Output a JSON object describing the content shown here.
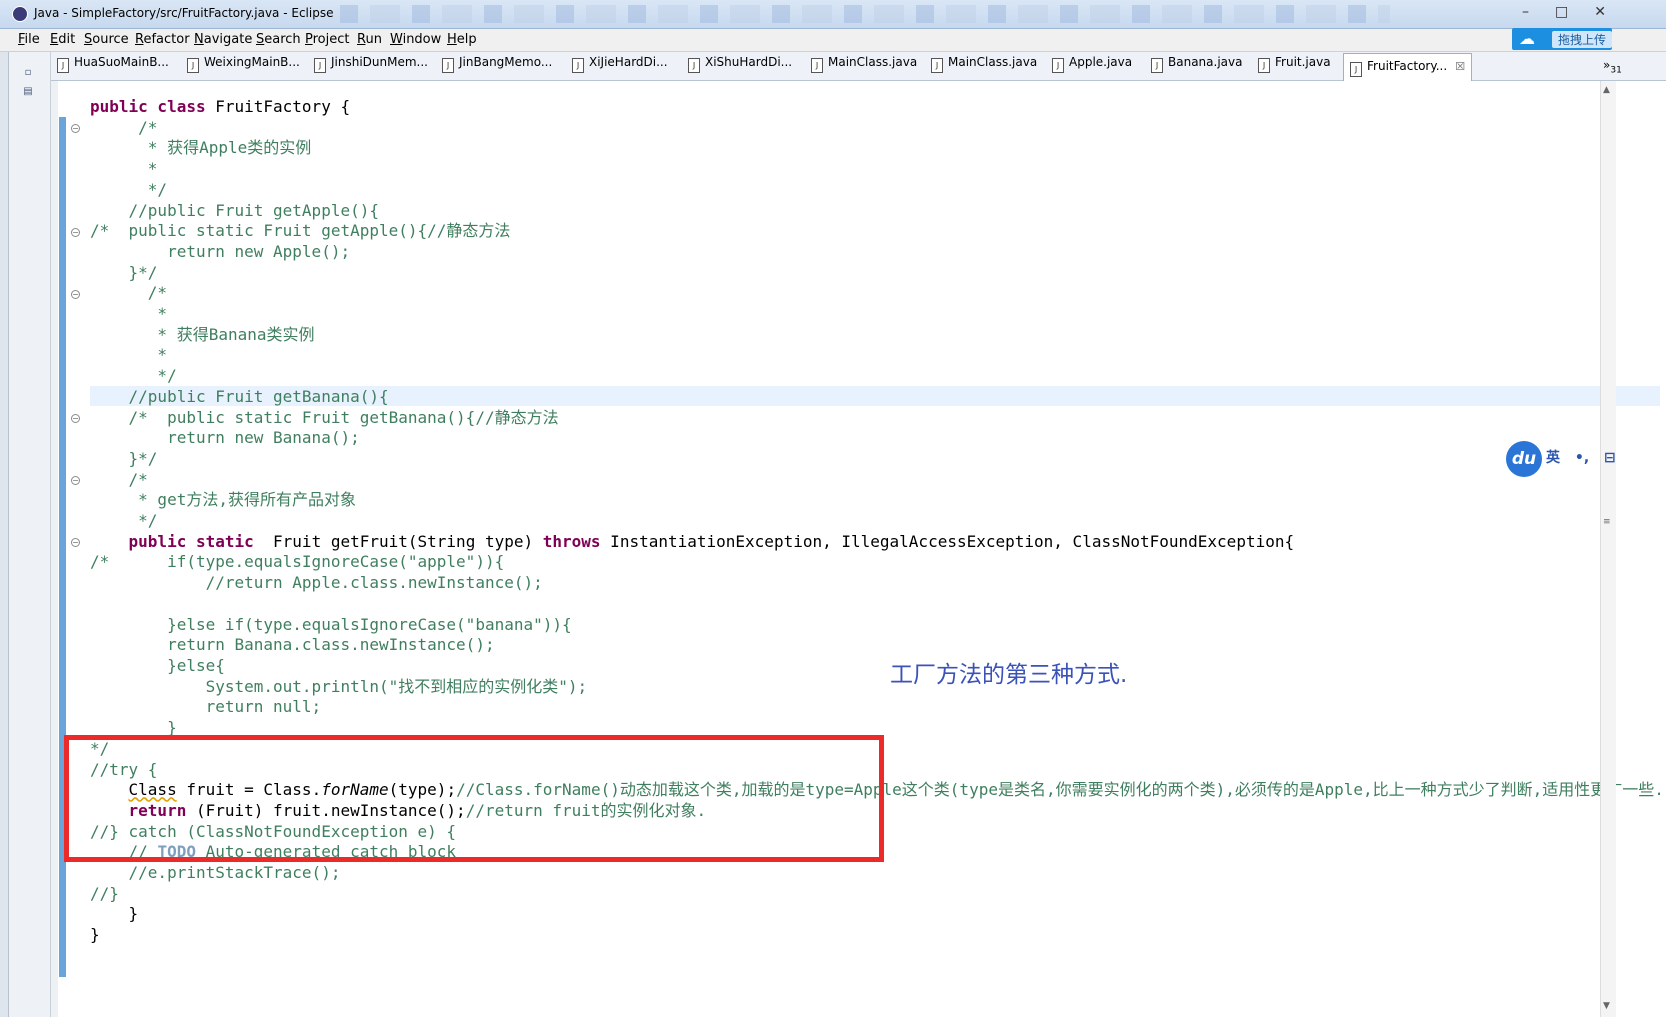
{
  "window": {
    "title": "Java - SimpleFactory/src/FruitFactory.java - Eclipse",
    "controls": [
      "–",
      "□",
      "✕"
    ]
  },
  "menu": [
    "File",
    "Edit",
    "Source",
    "Refactor",
    "Navigate",
    "Search",
    "Project",
    "Run",
    "Window",
    "Help"
  ],
  "upload_button": {
    "label": "拖拽上传",
    "icon": "cloud-icon"
  },
  "tabs": [
    "HuaSuoMainB...",
    "WeixingMainB...",
    "JinshiDunMem...",
    "JinBangMemo...",
    "XiJieHardDi...",
    "XiShuHardDi...",
    "MainClass.java",
    "MainClass.java",
    "Apple.java",
    "Banana.java",
    "Fruit.java"
  ],
  "active_tab": {
    "label": "FruitFactory...",
    "close": "☒"
  },
  "tabs_overflow": {
    "chevron": "»",
    "count": "31"
  },
  "code": {
    "l1": "public class FruitFactory {",
    "l2": "     /*",
    "l3": "      * 获得Apple类的实例",
    "l4": "      *",
    "l5": "      */",
    "l6": "    //public Fruit getApple(){",
    "l7": "/*  public static Fruit getApple(){//静态方法",
    "l8": "        return new Apple();",
    "l9": "    }*/",
    "l10": "      /*",
    "l11": "       *",
    "l12": "       * 获得Banana类实例",
    "l13": "       *",
    "l14": "       */",
    "l15": "    //public Fruit getBanana(){",
    "l16": "    /*  public static Fruit getBanana(){//静态方法",
    "l17": "        return new Banana();",
    "l18": "    }*/",
    "l19": "    /*",
    "l20": "     * get方法,获得所有产品对象",
    "l21": "     */",
    "l22": "    public static  Fruit getFruit(String type) throws InstantiationException, IllegalAccessException, ClassNotFoundException{",
    "l23": "/*      if(type.equalsIgnoreCase(\"apple\")){",
    "l24": "            //return Apple.class.newInstance();",
    "l25": "",
    "l26": "        }else if(type.equalsIgnoreCase(\"banana\")){",
    "l27": "        return Banana.class.newInstance();",
    "l28": "        }else{",
    "l29": "            System.out.println(\"找不到相应的实例化类\");",
    "l30": "            return null;",
    "l31": "        }",
    "l32": "*/",
    "l33": "//try {",
    "l34": "    Class fruit = Class.forName(type);//Class.forName()动态加载这个类,加载的是type=Apple这个类(type是类名,你需要实例化的两个类),必须传的是Apple,比上一种方式少了判断,适用性更广一些.",
    "l35": "    return (Fruit) fruit.newInstance();//return fruit的实例化对象.",
    "l36": "//} catch (ClassNotFoundException e) {",
    "l37": "    // TODO Auto-generated catch block",
    "l38": "    //e.printStackTrace();",
    "l39": "//}",
    "l40": "    }",
    "l41": "}"
  },
  "annotation": "工厂方法的第三种方式.",
  "ime_toolbar": {
    "logo": "du",
    "lang": "英",
    "punct": "•,",
    "toolbox": "⊟"
  },
  "colors": {
    "keyword": "#7f0055",
    "comment": "#3f7f5f",
    "string": "#2a00ff",
    "highlight_box": "#ec2a2a",
    "annotation": "#3b52b8"
  }
}
